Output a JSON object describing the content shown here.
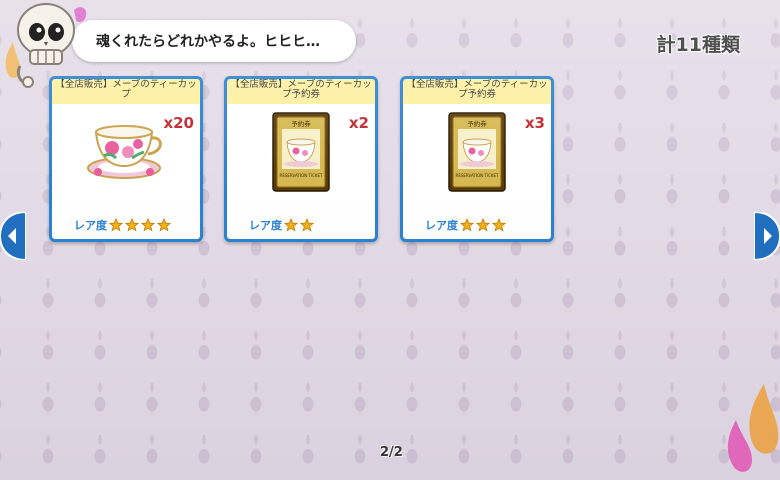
{
  "dialog": {
    "message": "魂くれたらどれかやるよ。ヒヒヒ…"
  },
  "header": {
    "total_count": "計11種類"
  },
  "items": [
    {
      "title": "【全店販売】メーブのティーカップ",
      "quantity": "x20",
      "rarity_label": "レア度",
      "stars": 4,
      "image": "teacup-icon"
    },
    {
      "title": "【全店販売】メーブのティーカップ予約券",
      "quantity": "x2",
      "rarity_label": "レア度",
      "stars": 2,
      "image": "reservation-ticket-icon",
      "ticket_top": "予約券",
      "ticket_bottom": "RESERVATION TICKET"
    },
    {
      "title": "【全店販売】メーブのティーカップ予約券",
      "quantity": "x3",
      "rarity_label": "レア度",
      "stars": 3,
      "image": "reservation-ticket-icon",
      "ticket_top": "予約券",
      "ticket_bottom": "RESERVATION TICKET"
    }
  ],
  "pagination": {
    "label": "2/2"
  },
  "colors": {
    "card_border": "#2a82d2",
    "title_bg": "#fdf0a0",
    "quantity": "#c0262d",
    "star": "#f3b21b"
  }
}
